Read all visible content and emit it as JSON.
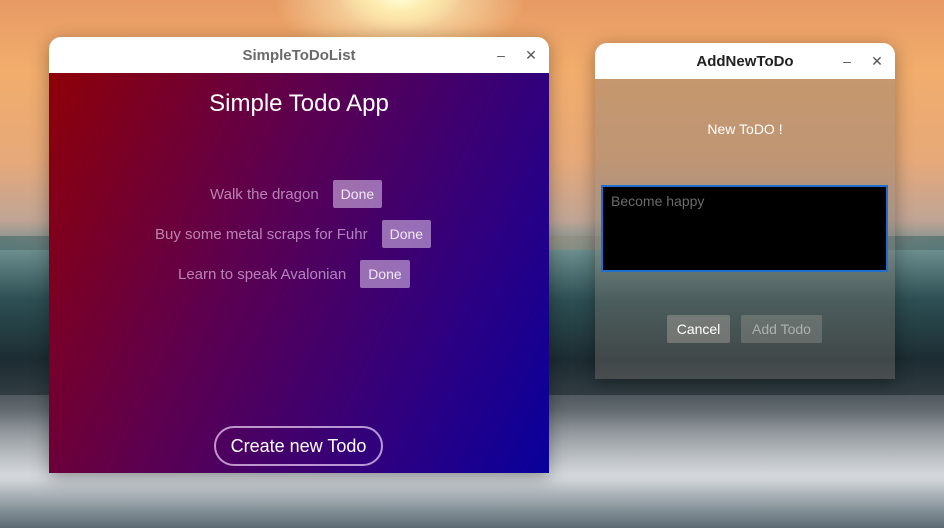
{
  "main_window": {
    "title": "SimpleToDoList",
    "minimize_label": "–",
    "close_label": "✕",
    "app_title": "Simple Todo App",
    "todos": [
      {
        "text": "Walk the dragon",
        "button": "Done"
      },
      {
        "text": "Buy some metal scraps for Fuhr",
        "button": "Done"
      },
      {
        "text": "Learn to speak Avalonian",
        "button": "Done"
      }
    ],
    "create_button": "Create new Todo"
  },
  "add_window": {
    "title": "AddNewToDo",
    "minimize_label": "–",
    "close_label": "✕",
    "label": "New ToDO !",
    "input_value": "",
    "input_placeholder": "Become happy",
    "cancel_button": "Cancel",
    "add_button": "Add Todo"
  },
  "colors": {
    "main_gradient_start": "#8e0008",
    "main_gradient_end": "#08009c",
    "input_focus_border": "#1f6fd1",
    "titlebar_bg": "#ffffff"
  },
  "icons": {
    "minimize": "minimize-icon",
    "close": "close-icon"
  }
}
